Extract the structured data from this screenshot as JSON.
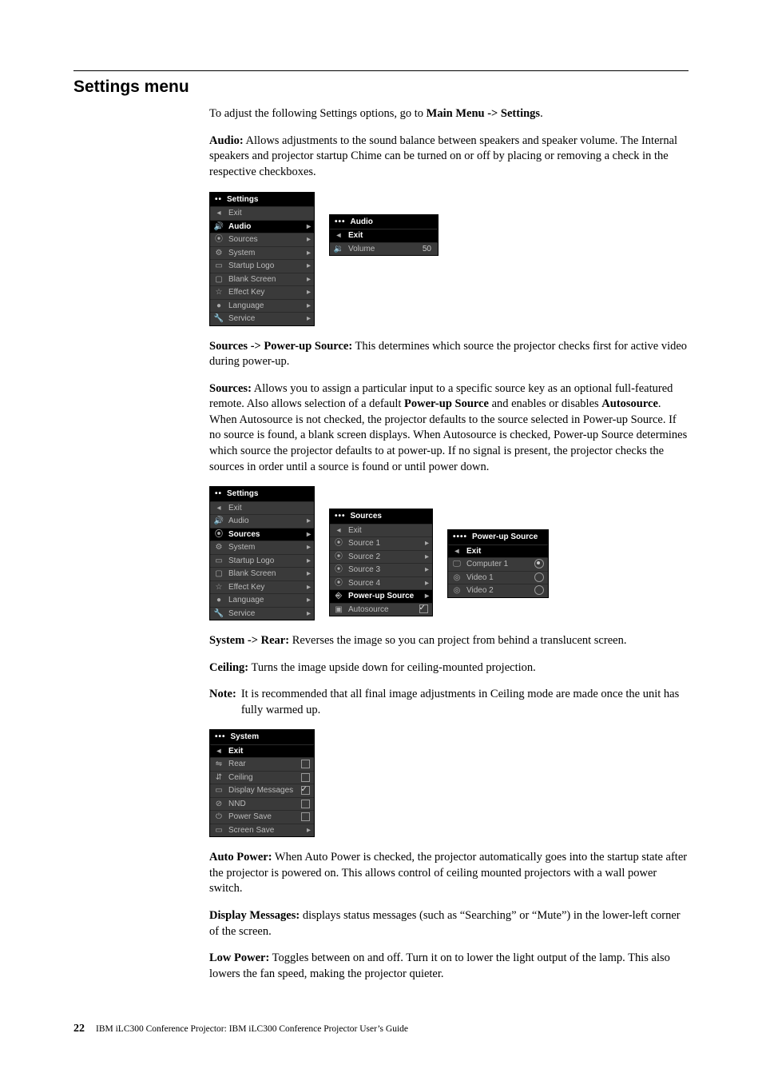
{
  "heading": "Settings menu",
  "intro": {
    "part1": "To adjust the following Settings options, go to ",
    "bold": "Main Menu -> Settings",
    "part2": "."
  },
  "audio_para": {
    "lead": "Audio:",
    "text": " Allows adjustments to the sound balance between speakers and speaker volume. The Internal speakers and projector startup Chime can be turned on or off by placing or removing a check in the respective checkboxes."
  },
  "fig1": {
    "settings": {
      "title": "Settings",
      "items": [
        "Exit",
        "Audio",
        "Sources",
        "System",
        "Startup Logo",
        "Blank Screen",
        "Effect Key",
        "Language",
        "Service"
      ],
      "selected": "Audio"
    },
    "audio": {
      "title": "Audio",
      "exit": "Exit",
      "volume_label": "Volume",
      "volume_value": "50"
    }
  },
  "sources_pus": {
    "lead": "Sources -> Power-up Source:",
    "text": " This determines which source the projector checks first for active video during power-up."
  },
  "sources_para": {
    "lead": "Sources:",
    "t1": " Allows you to assign a particular input to a specific source key as an optional full-featured remote. Also allows selection of a default ",
    "b1": "Power-up Source",
    "t2": " and enables or disables ",
    "b2": "Autosource",
    "t3": ". When Autosource is not checked, the projector defaults to the source selected in Power-up Source. If no source is found, a blank screen displays. When Autosource is checked, Power-up Source determines which source the projector defaults to at power-up. If no signal is present, the projector checks the sources in order until a source is found or until power down."
  },
  "fig2": {
    "settings": {
      "title": "Settings",
      "items": [
        "Exit",
        "Audio",
        "Sources",
        "System",
        "Startup Logo",
        "Blank Screen",
        "Effect Key",
        "Language",
        "Service"
      ],
      "selected": "Sources"
    },
    "sources": {
      "title": "Sources",
      "items": [
        "Exit",
        "Source 1",
        "Source 2",
        "Source 3",
        "Source 4",
        "Power-up Source",
        "Autosource"
      ],
      "selected": "Power-up Source",
      "autosource_checked": true
    },
    "pus": {
      "title": "Power-up Source",
      "exit": "Exit",
      "options": [
        {
          "label": "Computer 1",
          "on": true
        },
        {
          "label": "Video 1",
          "on": false
        },
        {
          "label": "Video 2",
          "on": false
        }
      ]
    }
  },
  "system_rear": {
    "lead": "System -> Rear:",
    "text": " Reverses the image so you can project from behind a translucent screen."
  },
  "ceiling": {
    "lead": "Ceiling:",
    "text": " Turns the image upside down for ceiling-mounted projection."
  },
  "note": {
    "lead": "Note:",
    "text": "It is recommended that all final image adjustments in Ceiling mode are made once the unit has fully warmed up."
  },
  "fig3": {
    "title": "System",
    "exit": "Exit",
    "items": [
      {
        "label": "Rear",
        "checked": false
      },
      {
        "label": "Ceiling",
        "checked": false
      },
      {
        "label": "Display Messages",
        "checked": true
      },
      {
        "label": "NND",
        "checked": false
      },
      {
        "label": "Power Save",
        "checked": false
      }
    ],
    "screen_save": "Screen Save"
  },
  "auto_power": {
    "lead": "Auto Power:",
    "text": " When Auto Power is checked, the projector automatically goes into the startup state after the projector is powered on. This allows control of ceiling mounted projectors with a wall power switch."
  },
  "display_messages": {
    "lead": "Display Messages:",
    "text": " displays status messages (such as “Searching” or “Mute”) in the lower-left corner of the screen."
  },
  "low_power": {
    "lead": "Low Power:",
    "text": " Toggles between on and off. Turn it on to lower the light output of the lamp. This also lowers the fan speed, making the projector quieter."
  },
  "footer": {
    "page": "22",
    "text": "IBM iLC300 Conference Projector: IBM iLC300 Conference Projector User’s Guide"
  }
}
